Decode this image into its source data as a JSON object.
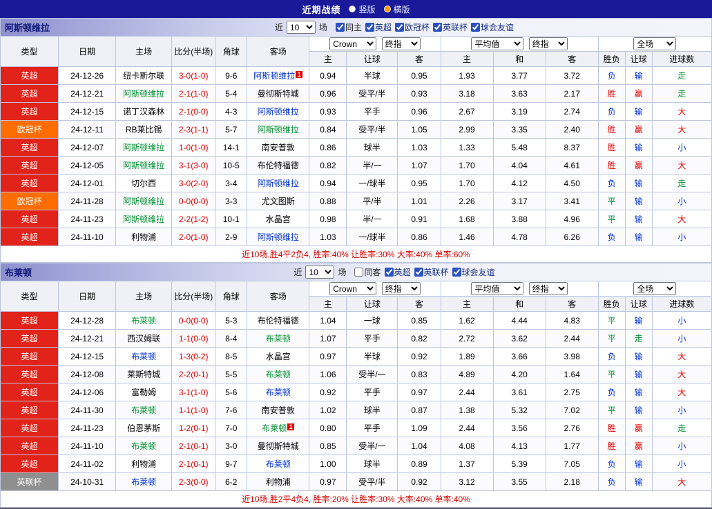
{
  "page": {
    "title": "近期战绩",
    "layout_options": [
      {
        "label": "竖版",
        "selected": false
      },
      {
        "label": "横版",
        "selected": true
      }
    ]
  },
  "labels": {
    "near": "近",
    "games": "场"
  },
  "columns": {
    "type": "类型",
    "date": "日期",
    "home": "主场",
    "score": "比分(半场)",
    "corners": "角球",
    "away": "客场",
    "odds_home": "主",
    "handicap": "让球",
    "odds_away": "客",
    "avg_home": "主",
    "avg_draw": "和",
    "avg_away": "客",
    "result": "胜负",
    "handicap_result": "让球",
    "goals": "进球数"
  },
  "selects": {
    "provider": "Crown",
    "final_odds": "终指",
    "average": "平均值",
    "scope": "全场"
  },
  "colors": {
    "league": {
      "英超": "#e2231a",
      "欧冠杯": "#ff6d00",
      "英联杯": "#8f8f8f"
    },
    "win_text": "#e00000",
    "draw_text": "#009030",
    "loss_text": "#0030cc"
  },
  "sections": [
    {
      "team": "阿斯顿维拉",
      "filter": {
        "count": "10",
        "checks": [
          {
            "label": "同主",
            "checked": true
          },
          {
            "label": "英超",
            "checked": true
          },
          {
            "label": "欧冠杯",
            "checked": true
          },
          {
            "label": "英联杯",
            "checked": true
          },
          {
            "label": "球会友谊",
            "checked": true
          }
        ]
      },
      "rows": [
        {
          "league": "英超",
          "date": "24-12-26",
          "home": "纽卡斯尔联",
          "score": "3-0(1-0)",
          "corners": "9-6",
          "away": "阿斯顿维拉",
          "focal": "away",
          "red_card": {
            "side": "away",
            "count": "1"
          },
          "odds_home": "0.94",
          "handicap": "半球",
          "odds_away": "0.95",
          "avg_home": "1.93",
          "avg_draw": "3.77",
          "avg_away": "3.72",
          "result": "负",
          "handicap_result": "输",
          "goals": "走"
        },
        {
          "league": "英超",
          "date": "24-12-21",
          "home": "阿斯顿维拉",
          "score": "2-1(1-0)",
          "corners": "5-4",
          "away": "曼彻斯特城",
          "focal": "home",
          "odds_home": "0.96",
          "handicap": "受平/半",
          "odds_away": "0.93",
          "avg_home": "3.18",
          "avg_draw": "3.63",
          "avg_away": "2.17",
          "result": "胜",
          "handicap_result": "赢",
          "goals": "走"
        },
        {
          "league": "英超",
          "date": "24-12-15",
          "home": "诺丁汉森林",
          "score": "2-1(0-0)",
          "corners": "4-3",
          "away": "阿斯顿维拉",
          "focal": "away",
          "odds_home": "0.93",
          "handicap": "平手",
          "odds_away": "0.96",
          "avg_home": "2.67",
          "avg_draw": "3.19",
          "avg_away": "2.74",
          "result": "负",
          "handicap_result": "输",
          "goals": "大"
        },
        {
          "league": "欧冠杯",
          "date": "24-12-11",
          "home": "RB莱比锡",
          "score": "2-3(1-1)",
          "corners": "5-7",
          "away": "阿斯顿维拉",
          "focal": "away",
          "odds_home": "0.84",
          "handicap": "受平/半",
          "odds_away": "1.05",
          "avg_home": "2.99",
          "avg_draw": "3.35",
          "avg_away": "2.40",
          "result": "胜",
          "handicap_result": "赢",
          "goals": "大"
        },
        {
          "league": "英超",
          "date": "24-12-07",
          "home": "阿斯顿维拉",
          "score": "1-0(1-0)",
          "corners": "14-1",
          "away": "南安普敦",
          "focal": "home",
          "odds_home": "0.86",
          "handicap": "球半",
          "odds_away": "1.03",
          "avg_home": "1.33",
          "avg_draw": "5.48",
          "avg_away": "8.37",
          "result": "胜",
          "handicap_result": "输",
          "goals": "小"
        },
        {
          "league": "英超",
          "date": "24-12-05",
          "home": "阿斯顿维拉",
          "score": "3-1(3-0)",
          "corners": "10-5",
          "away": "布伦特福德",
          "focal": "home",
          "odds_home": "0.82",
          "handicap": "半/一",
          "odds_away": "1.07",
          "avg_home": "1.70",
          "avg_draw": "4.04",
          "avg_away": "4.61",
          "result": "胜",
          "handicap_result": "赢",
          "goals": "大"
        },
        {
          "league": "英超",
          "date": "24-12-01",
          "home": "切尔西",
          "score": "3-0(2-0)",
          "corners": "3-4",
          "away": "阿斯顿维拉",
          "focal": "away",
          "odds_home": "0.94",
          "handicap": "一/球半",
          "odds_away": "0.95",
          "avg_home": "1.70",
          "avg_draw": "4.12",
          "avg_away": "4.50",
          "result": "负",
          "handicap_result": "输",
          "goals": "走"
        },
        {
          "league": "欧冠杯",
          "date": "24-11-28",
          "home": "阿斯顿维拉",
          "score": "0-0(0-0)",
          "corners": "3-3",
          "away": "尤文图斯",
          "focal": "home",
          "odds_home": "0.88",
          "handicap": "平/半",
          "odds_away": "1.01",
          "avg_home": "2.26",
          "avg_draw": "3.17",
          "avg_away": "3.41",
          "result": "平",
          "handicap_result": "输",
          "goals": "小"
        },
        {
          "league": "英超",
          "date": "24-11-23",
          "home": "阿斯顿维拉",
          "score": "2-2(1-2)",
          "corners": "10-1",
          "away": "水晶宫",
          "focal": "home",
          "odds_home": "0.98",
          "handicap": "半/一",
          "odds_away": "0.91",
          "avg_home": "1.68",
          "avg_draw": "3.88",
          "avg_away": "4.96",
          "result": "平",
          "handicap_result": "输",
          "goals": "大"
        },
        {
          "league": "英超",
          "date": "24-11-10",
          "home": "利物浦",
          "score": "2-0(1-0)",
          "corners": "2-9",
          "away": "阿斯顿维拉",
          "focal": "away",
          "odds_home": "1.03",
          "handicap": "一/球半",
          "odds_away": "0.86",
          "avg_home": "1.46",
          "avg_draw": "4.78",
          "avg_away": "6.26",
          "result": "负",
          "handicap_result": "输",
          "goals": "小"
        }
      ],
      "summary": "近10场,胜4平2负4, 胜率:40% 让胜率:30% 大率:40% 单率:60%"
    },
    {
      "team": "布莱顿",
      "filter": {
        "count": "10",
        "checks": [
          {
            "label": "同客",
            "checked": false
          },
          {
            "label": "英超",
            "checked": true
          },
          {
            "label": "英联杯",
            "checked": true
          },
          {
            "label": "球会友谊",
            "checked": true
          }
        ]
      },
      "rows": [
        {
          "league": "英超",
          "date": "24-12-28",
          "home": "布莱顿",
          "score": "0-0(0-0)",
          "corners": "5-3",
          "away": "布伦特福德",
          "focal": "home",
          "odds_home": "1.04",
          "handicap": "一球",
          "odds_away": "0.85",
          "avg_home": "1.62",
          "avg_draw": "4.44",
          "avg_away": "4.83",
          "result": "平",
          "handicap_result": "输",
          "goals": "小"
        },
        {
          "league": "英超",
          "date": "24-12-21",
          "home": "西汉姆联",
          "score": "1-1(0-0)",
          "corners": "8-4",
          "away": "布莱顿",
          "focal": "away",
          "odds_home": "1.07",
          "handicap": "平手",
          "odds_away": "0.82",
          "avg_home": "2.72",
          "avg_draw": "3.62",
          "avg_away": "2.44",
          "result": "平",
          "handicap_result": "走",
          "goals": "小"
        },
        {
          "league": "英超",
          "date": "24-12-15",
          "home": "布莱顿",
          "score": "1-3(0-2)",
          "corners": "8-5",
          "away": "水晶宫",
          "focal": "home",
          "odds_home": "0.97",
          "handicap": "半球",
          "odds_away": "0.92",
          "avg_home": "1.89",
          "avg_draw": "3.66",
          "avg_away": "3.98",
          "result": "负",
          "handicap_result": "输",
          "goals": "大"
        },
        {
          "league": "英超",
          "date": "24-12-08",
          "home": "莱斯特城",
          "score": "2-2(0-1)",
          "corners": "5-5",
          "away": "布莱顿",
          "focal": "away",
          "odds_home": "1.06",
          "handicap": "受半/一",
          "odds_away": "0.83",
          "avg_home": "4.89",
          "avg_draw": "4.20",
          "avg_away": "1.64",
          "result": "平",
          "handicap_result": "输",
          "goals": "大"
        },
        {
          "league": "英超",
          "date": "24-12-06",
          "home": "富勒姆",
          "score": "3-1(1-0)",
          "corners": "5-6",
          "away": "布莱顿",
          "focal": "away",
          "odds_home": "0.92",
          "handicap": "平手",
          "odds_away": "0.97",
          "avg_home": "2.44",
          "avg_draw": "3.61",
          "avg_away": "2.75",
          "result": "负",
          "handicap_result": "输",
          "goals": "大"
        },
        {
          "league": "英超",
          "date": "24-11-30",
          "home": "布莱顿",
          "score": "1-1(1-0)",
          "corners": "7-6",
          "away": "南安普敦",
          "focal": "home",
          "odds_home": "1.02",
          "handicap": "球半",
          "odds_away": "0.87",
          "avg_home": "1.38",
          "avg_draw": "5.32",
          "avg_away": "7.02",
          "result": "平",
          "handicap_result": "输",
          "goals": "小"
        },
        {
          "league": "英超",
          "date": "24-11-23",
          "home": "伯恩茅斯",
          "score": "1-2(0-1)",
          "corners": "7-0",
          "away": "布莱顿",
          "focal": "away",
          "red_card": {
            "side": "away",
            "count": "1"
          },
          "odds_home": "0.80",
          "handicap": "平手",
          "odds_away": "1.09",
          "avg_home": "2.44",
          "avg_draw": "3.56",
          "avg_away": "2.76",
          "result": "胜",
          "handicap_result": "赢",
          "goals": "走"
        },
        {
          "league": "英超",
          "date": "24-11-10",
          "home": "布莱顿",
          "score": "2-1(0-1)",
          "corners": "3-0",
          "away": "曼彻斯特城",
          "focal": "home",
          "odds_home": "0.85",
          "handicap": "受半/一",
          "odds_away": "1.04",
          "avg_home": "4.08",
          "avg_draw": "4.13",
          "avg_away": "1.77",
          "result": "胜",
          "handicap_result": "赢",
          "goals": "小"
        },
        {
          "league": "英超",
          "date": "24-11-02",
          "home": "利物浦",
          "score": "2-1(0-1)",
          "corners": "9-7",
          "away": "布莱顿",
          "focal": "away",
          "odds_home": "1.00",
          "handicap": "球半",
          "odds_away": "0.89",
          "avg_home": "1.37",
          "avg_draw": "5.39",
          "avg_away": "7.05",
          "result": "负",
          "handicap_result": "输",
          "goals": "小"
        },
        {
          "league": "英联杯",
          "date": "24-10-31",
          "home": "布莱顿",
          "score": "2-3(0-0)",
          "corners": "6-2",
          "away": "利物浦",
          "focal": "home",
          "odds_home": "0.97",
          "handicap": "受平/半",
          "odds_away": "0.92",
          "avg_home": "3.12",
          "avg_draw": "3.55",
          "avg_away": "2.18",
          "result": "负",
          "handicap_result": "输",
          "goals": "大"
        }
      ],
      "summary": "近10场,胜2平4负4, 胜率:20% 让胜率:30% 大率:40% 单率:40%"
    }
  ]
}
